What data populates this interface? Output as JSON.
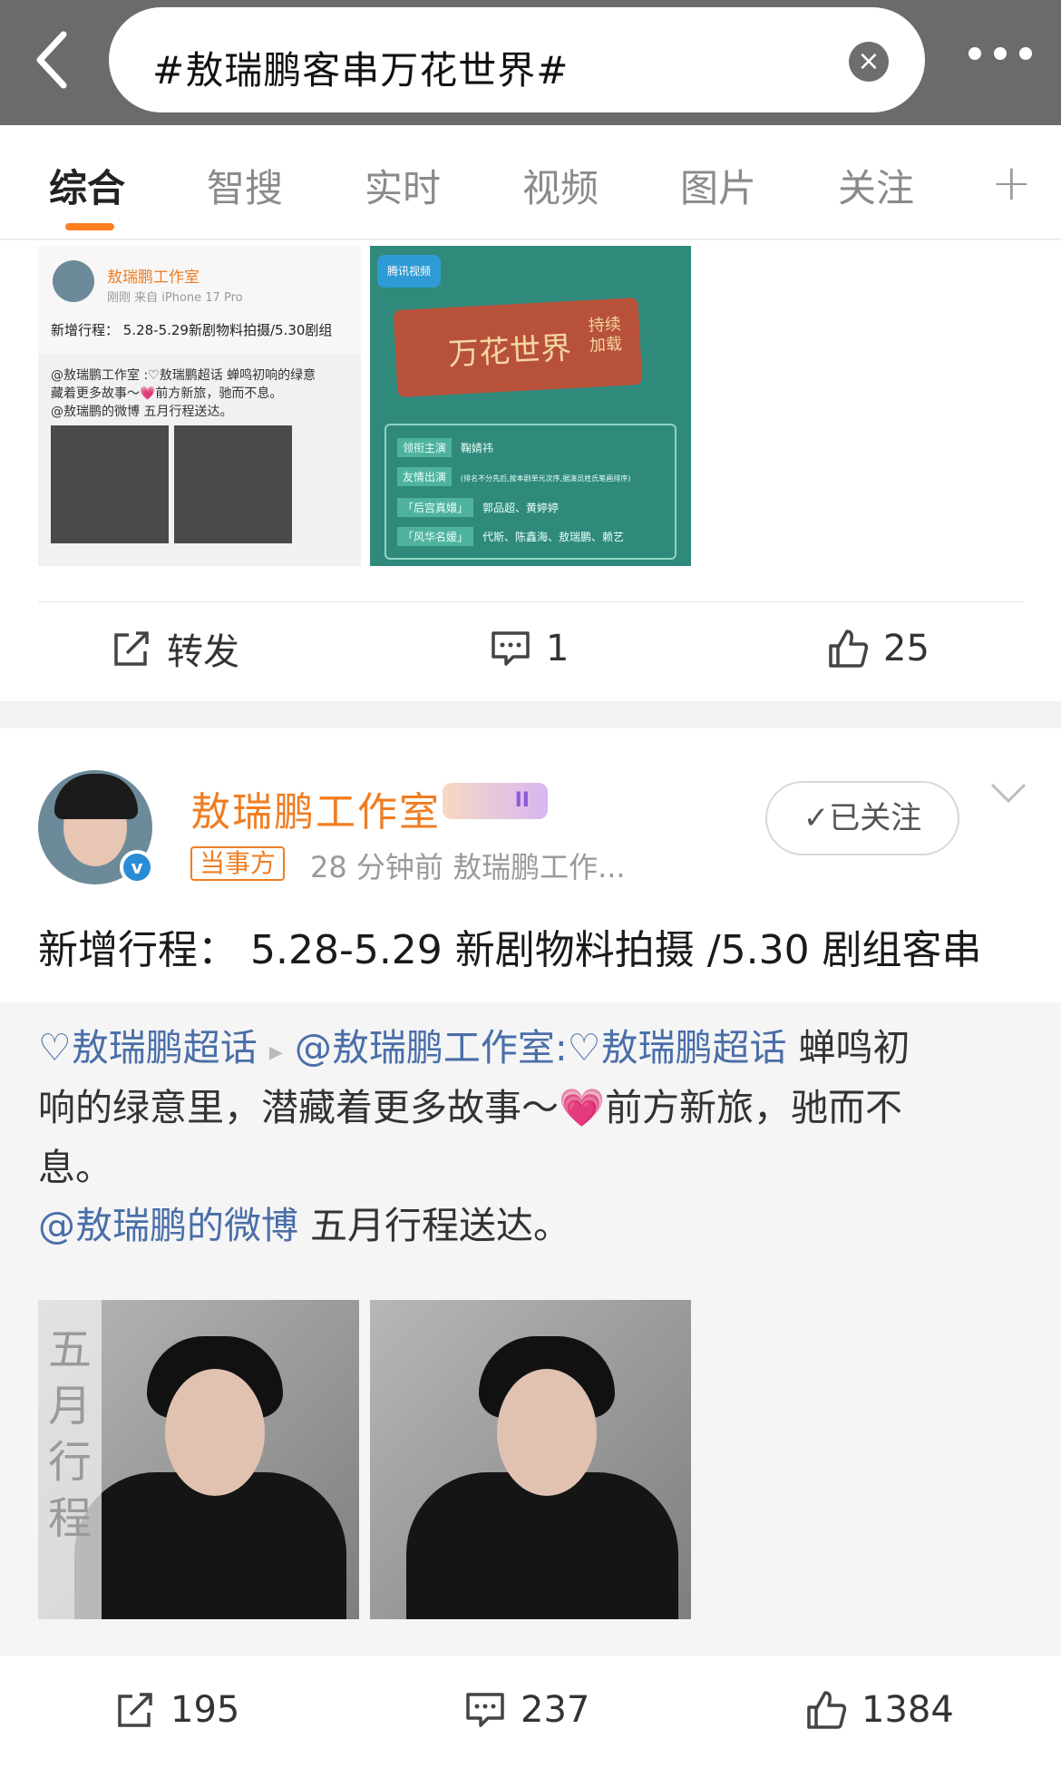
{
  "search": {
    "query": "#敖瑞鹏客串万花世界#"
  },
  "tabs": {
    "items": [
      "综合",
      "智搜",
      "实时",
      "视频",
      "图片",
      "关注"
    ],
    "active_index": 0,
    "plus": "+"
  },
  "card1": {
    "thumb1": {
      "name": "敖瑞鹏工作室",
      "sub": "刚刚  来自 iPhone 17 Pro",
      "text": "新增行程： 5.28-5.29新剧物料拍摄/5.30剧组",
      "repost_line1": "@敖瑞鹏工作室 :♡敖瑞鹏超话  蝉鸣初响的绿意",
      "repost_line2": "藏着更多故事～💗前方新旅，驰而不息。",
      "repost_line3": "@敖瑞鹏的微博 五月行程送达。"
    },
    "thumb2": {
      "logo": "腾讯视频",
      "title": "万花世界",
      "subtitle": "持续加载",
      "rows": [
        {
          "tag": "领衔主演",
          "text": "鞠婧祎"
        },
        {
          "tag": "友情出演",
          "text": "(排名不分先后,按本剧单元次序,据演员姓氏笔画排序)"
        },
        {
          "tag": "「后宫真嬛」",
          "text": "郭品超、黄婷婷"
        },
        {
          "tag": "「风华名媛」",
          "text": "代斯、陈鑫海、敖瑞鹏、赖艺"
        }
      ]
    },
    "actions": {
      "repost": "转发",
      "comment": "1",
      "like": "25"
    }
  },
  "card2": {
    "author": "敖瑞鹏工作室",
    "badge_level": "II",
    "role": "当事方",
    "meta": "28 分钟前  敖瑞鹏工作...",
    "follow": "已关注",
    "text": "新增行程：  5.28-5.29 新剧物料拍摄 /5.30 剧组客串",
    "repost": {
      "topic1": "♡敖瑞鹏超话",
      "arrow": "▸",
      "mention": "@敖瑞鹏工作室:",
      "topic2": "♡敖瑞鹏超话",
      "text1": " 蝉鸣初",
      "line2a": "响的绿意里，潜藏着更多故事～",
      "heart": "💗",
      "line2b": "前方新旅，驰而不",
      "line3": "息。",
      "mention2": "@敖瑞鹏的微博",
      "line4": " 五月行程送达。"
    },
    "photo_caption": "五月行程",
    "actions": {
      "repost": "195",
      "comment": "237",
      "like": "1384"
    }
  },
  "colors": {
    "accent": "#f07d22",
    "link": "#4a6ea8",
    "tab_underline": "#ff7e1f"
  }
}
